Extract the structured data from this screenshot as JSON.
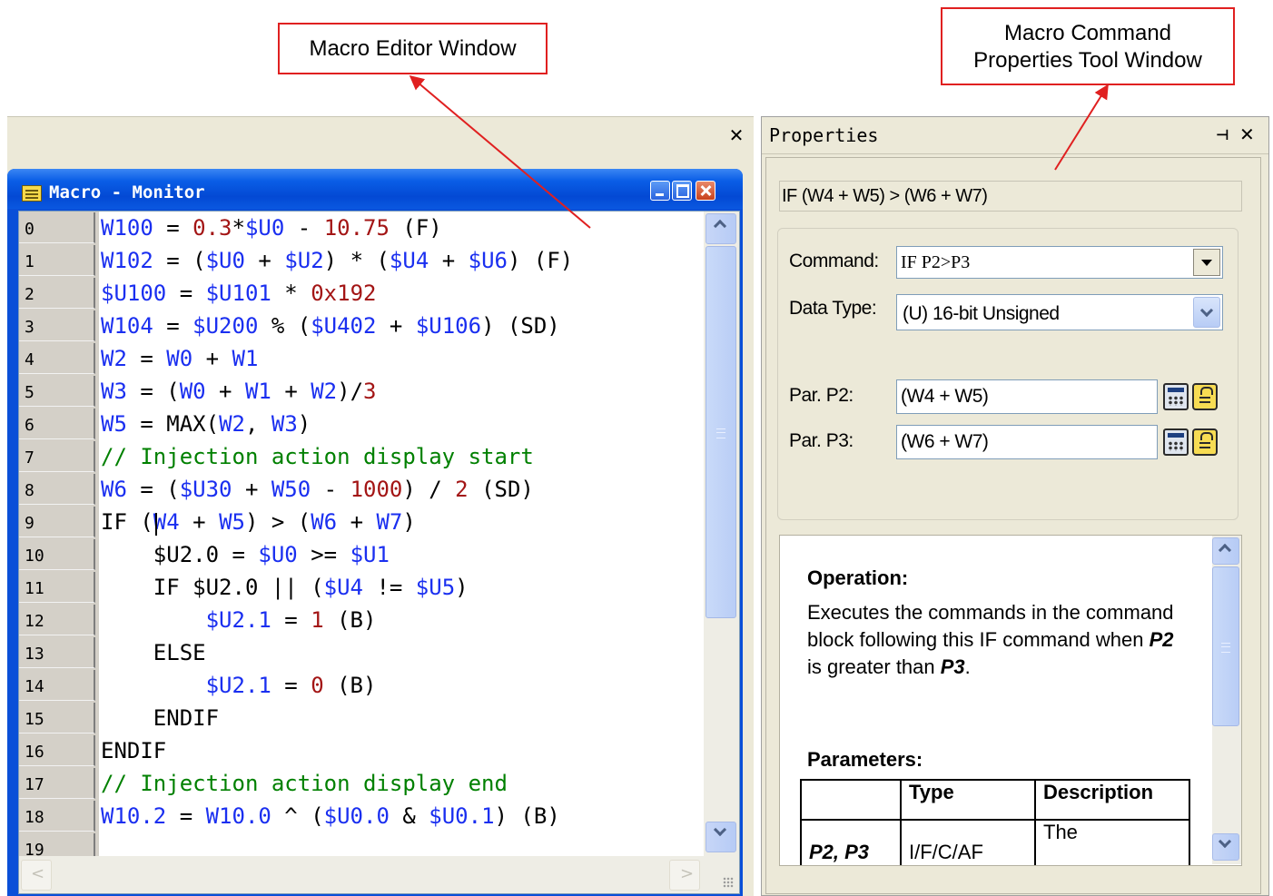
{
  "callouts": {
    "editor": "Macro Editor Window",
    "properties_line1": "Macro Command",
    "properties_line2": "Properties Tool Window"
  },
  "macro_window": {
    "title": "Macro - Monitor",
    "lines": [
      {
        "num": "0",
        "tokens": [
          {
            "t": "W100",
            "c": "blue"
          },
          {
            "t": " = ",
            "c": "black"
          },
          {
            "t": "0.3",
            "c": "red"
          },
          {
            "t": "*",
            "c": "black"
          },
          {
            "t": "$U0",
            "c": "blue"
          },
          {
            "t": " - ",
            "c": "black"
          },
          {
            "t": "10.75",
            "c": "red"
          },
          {
            "t": " (F)",
            "c": "black"
          }
        ]
      },
      {
        "num": "1",
        "tokens": [
          {
            "t": "W102",
            "c": "blue"
          },
          {
            "t": " = (",
            "c": "black"
          },
          {
            "t": "$U0",
            "c": "blue"
          },
          {
            "t": " + ",
            "c": "black"
          },
          {
            "t": "$U2",
            "c": "blue"
          },
          {
            "t": ") * (",
            "c": "black"
          },
          {
            "t": "$U4",
            "c": "blue"
          },
          {
            "t": " + ",
            "c": "black"
          },
          {
            "t": "$U6",
            "c": "blue"
          },
          {
            "t": ") (F)",
            "c": "black"
          }
        ]
      },
      {
        "num": "2",
        "tokens": [
          {
            "t": "$U100",
            "c": "blue"
          },
          {
            "t": " = ",
            "c": "black"
          },
          {
            "t": "$U101",
            "c": "blue"
          },
          {
            "t": " * ",
            "c": "black"
          },
          {
            "t": "0x192",
            "c": "red"
          }
        ]
      },
      {
        "num": "3",
        "tokens": [
          {
            "t": "W104",
            "c": "blue"
          },
          {
            "t": " = ",
            "c": "black"
          },
          {
            "t": "$U200",
            "c": "blue"
          },
          {
            "t": " % (",
            "c": "black"
          },
          {
            "t": "$U402",
            "c": "blue"
          },
          {
            "t": " + ",
            "c": "black"
          },
          {
            "t": "$U106",
            "c": "blue"
          },
          {
            "t": ") (SD)",
            "c": "black"
          }
        ]
      },
      {
        "num": "4",
        "tokens": [
          {
            "t": "W2",
            "c": "blue"
          },
          {
            "t": " = ",
            "c": "black"
          },
          {
            "t": "W0",
            "c": "blue"
          },
          {
            "t": " + ",
            "c": "black"
          },
          {
            "t": "W1",
            "c": "blue"
          }
        ]
      },
      {
        "num": "5",
        "tokens": [
          {
            "t": "W3",
            "c": "blue"
          },
          {
            "t": " = (",
            "c": "black"
          },
          {
            "t": "W0",
            "c": "blue"
          },
          {
            "t": " + ",
            "c": "black"
          },
          {
            "t": "W1",
            "c": "blue"
          },
          {
            "t": " + ",
            "c": "black"
          },
          {
            "t": "W2",
            "c": "blue"
          },
          {
            "t": ")/",
            "c": "black"
          },
          {
            "t": "3",
            "c": "red"
          }
        ]
      },
      {
        "num": "6",
        "tokens": [
          {
            "t": "W5",
            "c": "blue"
          },
          {
            "t": " = MAX(",
            "c": "black"
          },
          {
            "t": "W2",
            "c": "blue"
          },
          {
            "t": ", ",
            "c": "black"
          },
          {
            "t": "W3",
            "c": "blue"
          },
          {
            "t": ")",
            "c": "black"
          }
        ]
      },
      {
        "num": "7",
        "tokens": [
          {
            "t": "// Injection action display start",
            "c": "green"
          }
        ]
      },
      {
        "num": "8",
        "tokens": [
          {
            "t": "W6",
            "c": "blue"
          },
          {
            "t": " = (",
            "c": "black"
          },
          {
            "t": "$U30",
            "c": "blue"
          },
          {
            "t": " + ",
            "c": "black"
          },
          {
            "t": "W50",
            "c": "blue"
          },
          {
            "t": " - ",
            "c": "black"
          },
          {
            "t": "1000",
            "c": "red"
          },
          {
            "t": ") / ",
            "c": "black"
          },
          {
            "t": "2",
            "c": "red"
          },
          {
            "t": " (SD)",
            "c": "black"
          }
        ]
      },
      {
        "num": "9",
        "tokens": [
          {
            "t": "IF (",
            "c": "black"
          },
          {
            "t": "W4",
            "c": "blue"
          },
          {
            "t": " + ",
            "c": "black"
          },
          {
            "t": "W5",
            "c": "blue"
          },
          {
            "t": ") > (",
            "c": "black"
          },
          {
            "t": "W6",
            "c": "blue"
          },
          {
            "t": " + ",
            "c": "black"
          },
          {
            "t": "W7",
            "c": "blue"
          },
          {
            "t": ")",
            "c": "black"
          }
        ]
      },
      {
        "num": "10",
        "tokens": [
          {
            "t": "    ",
            "c": "black"
          },
          {
            "t": "$U2.0",
            "c": "black"
          },
          {
            "t": " = ",
            "c": "black"
          },
          {
            "t": "$U0",
            "c": "blue"
          },
          {
            "t": " >= ",
            "c": "black"
          },
          {
            "t": "$U1",
            "c": "blue"
          }
        ]
      },
      {
        "num": "11",
        "tokens": [
          {
            "t": "    IF $U2.0 || (",
            "c": "black"
          },
          {
            "t": "$U4",
            "c": "blue"
          },
          {
            "t": " != ",
            "c": "black"
          },
          {
            "t": "$U5",
            "c": "blue"
          },
          {
            "t": ")",
            "c": "black"
          }
        ]
      },
      {
        "num": "12",
        "tokens": [
          {
            "t": "        ",
            "c": "black"
          },
          {
            "t": "$U2.1",
            "c": "blue"
          },
          {
            "t": " = ",
            "c": "black"
          },
          {
            "t": "1",
            "c": "red"
          },
          {
            "t": " (B)",
            "c": "black"
          }
        ]
      },
      {
        "num": "13",
        "tokens": [
          {
            "t": "    ELSE",
            "c": "black"
          }
        ]
      },
      {
        "num": "14",
        "tokens": [
          {
            "t": "        ",
            "c": "black"
          },
          {
            "t": "$U2.1",
            "c": "blue"
          },
          {
            "t": " = ",
            "c": "black"
          },
          {
            "t": "0",
            "c": "red"
          },
          {
            "t": " (B)",
            "c": "black"
          }
        ]
      },
      {
        "num": "15",
        "tokens": [
          {
            "t": "    ENDIF",
            "c": "black"
          }
        ]
      },
      {
        "num": "16",
        "tokens": [
          {
            "t": "ENDIF",
            "c": "black"
          }
        ]
      },
      {
        "num": "17",
        "tokens": [
          {
            "t": "// Injection action display end",
            "c": "green"
          }
        ]
      },
      {
        "num": "18",
        "tokens": [
          {
            "t": "W10.2",
            "c": "blue"
          },
          {
            "t": " = ",
            "c": "black"
          },
          {
            "t": "W10.0",
            "c": "blue"
          },
          {
            "t": " ^ (",
            "c": "black"
          },
          {
            "t": "$U0.0",
            "c": "blue"
          },
          {
            "t": " & ",
            "c": "black"
          },
          {
            "t": "$U0.1",
            "c": "blue"
          },
          {
            "t": ") (B)",
            "c": "black"
          }
        ]
      },
      {
        "num": "19",
        "tokens": []
      }
    ]
  },
  "properties": {
    "title": "Properties",
    "expression": "IF (W4 + W5) > (W6 + W7)",
    "command_label": "Command:",
    "command_value": "IF P2>P3",
    "data_type_label": "Data Type:",
    "data_type_value": "(U) 16-bit Unsigned",
    "par_p2_label": "Par. P2:",
    "par_p2_value": "(W4 + W5)",
    "par_p3_label": "Par. P3:",
    "par_p3_value": "(W6 + W7)",
    "help": {
      "operation_heading": "Operation:",
      "operation_text_1": "Executes the commands in the command block  following this IF command when ",
      "operation_p2": "P2",
      "operation_text_2": " is greater than ",
      "operation_p3": "P3",
      "operation_text_3": ".",
      "parameters_heading": "Parameters:",
      "table_headers": [
        "",
        "Type",
        "Description"
      ],
      "table_row": [
        "P2, P3",
        "I/F/C/AF",
        "The"
      ]
    }
  },
  "colors": {
    "xp_blue": "#0a4fd8",
    "code_blue": "#1a2ff0",
    "code_red": "#a31515",
    "code_green": "#008000",
    "callout_red": "#e02020"
  }
}
